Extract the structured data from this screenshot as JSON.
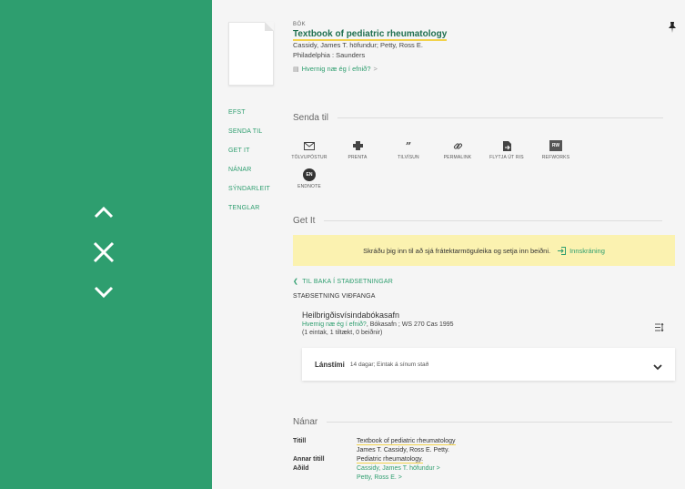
{
  "viewer": {
    "up_icon": "chevron-up-icon",
    "close_icon": "close-icon",
    "down_icon": "chevron-down-icon"
  },
  "record": {
    "type": "BÓK",
    "title": "Textbook of pediatric rheumatology",
    "authors": "Cassidy, James T. höfundur; Petty, Ross E.",
    "publisher": "Philadelphia : Saunders",
    "access_link": "Hvernig næ ég í efnið?",
    "access_chevron": ">"
  },
  "sidenav": [
    "EFST",
    "SENDA TIL",
    "GET IT",
    "NÁNAR",
    "SÝNDARLEIT",
    "TENGLAR"
  ],
  "send_to": {
    "title": "Senda til",
    "actions": [
      {
        "icon": "envelope-icon",
        "label": "TÖLVUPÓSTUR"
      },
      {
        "icon": "printer-icon",
        "label": "PRENTA"
      },
      {
        "icon": "quote-icon",
        "label": "TILVÍSUN"
      },
      {
        "icon": "link-icon",
        "label": "PERMALINK"
      },
      {
        "icon": "file-export-icon",
        "label": "FLYTJA ÚT RIS"
      },
      {
        "icon": "refworks-icon",
        "label": "REFWORKS",
        "badge": "RW"
      },
      {
        "icon": "endnote-icon",
        "label": "ENDNOTE",
        "badge": "EN"
      }
    ]
  },
  "get_it": {
    "title": "Get It",
    "signin_text": "Skráðu þig inn til að sjá frátektarmöguleika og setja inn beiðni.",
    "login_label": "Innskráning",
    "back_label": "TIL BAKA Í STAÐSETNINGAR",
    "location_header": "STAÐSETNING VIÐFANGA",
    "library_name": "Heilbrigðisvísindabókasafn",
    "library_link": "Hvernig næ ég í efnið?",
    "library_detail": ", Bókasafn ; WS 270 Cas 1995",
    "availability": "(1 eintak, 1 tiltækt, 0 beiðnir)",
    "loan_title": "Lánstími",
    "loan_detail": "14 dagar; Eintak á sínum stað"
  },
  "details": {
    "title": "Nánar",
    "rows": [
      {
        "key": "Titill",
        "value": "Textbook of pediatric rheumatology"
      },
      {
        "key": "",
        "value": "James T. Cassidy, Ross E. Petty."
      },
      {
        "key": "Annar titill",
        "value": "Pediatric rheumatology."
      },
      {
        "key": "Aðild",
        "value": "Cassidy, James T. höfundur"
      },
      {
        "key": "",
        "value": "Petty, Ross E."
      }
    ]
  }
}
